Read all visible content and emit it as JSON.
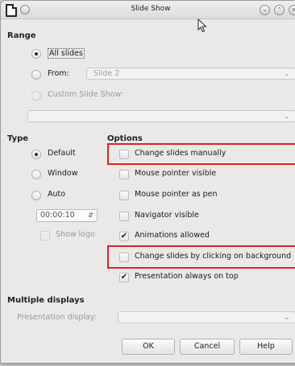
{
  "window": {
    "title": "Slide Show"
  },
  "range": {
    "heading": "Range",
    "all_slides": "All slides",
    "from_label": "From:",
    "from_value": "Slide 2",
    "custom_label": "Custom Slide Show:"
  },
  "type": {
    "heading": "Type",
    "default": "Default",
    "window": "Window",
    "auto": "Auto",
    "time": "00:00:10",
    "show_logo": "Show logo"
  },
  "options": {
    "heading": "Options",
    "change_manually": "Change slides manually",
    "pointer_visible": "Mouse pointer visible",
    "pointer_pen": "Mouse pointer as pen",
    "navigator": "Navigator visible",
    "animations": "Animations allowed",
    "change_bg": "Change slides by clicking on background",
    "always_top": "Presentation always on top"
  },
  "displays": {
    "heading": "Multiple displays",
    "presentation_display": "Presentation display:"
  },
  "buttons": {
    "ok": "OK",
    "cancel": "Cancel",
    "help": "Help"
  },
  "colors": {
    "highlight": "#dd1f28",
    "dialog_bg": "#eae9e7"
  }
}
